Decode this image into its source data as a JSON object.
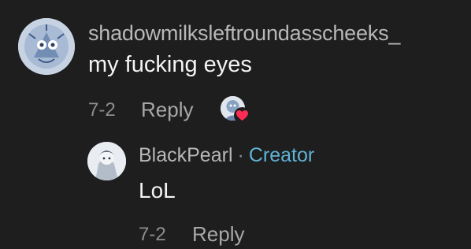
{
  "comment": {
    "username": "shadowmilksleftroundasscheeks_",
    "text": "my fucking eyes",
    "date": "7-2",
    "reply_label": "Reply",
    "avatar_icon": "snowflake-character-avatar",
    "liked_by_icon": "creator-avatar-heart",
    "heart_color": "#fe2c55"
  },
  "reply": {
    "username": "BlackPearl",
    "separator": "·",
    "badge": "Creator",
    "text": "LoL",
    "date": "7-2",
    "reply_label": "Reply",
    "avatar_icon": "character-avatar",
    "badge_color": "#5fb3d6"
  }
}
